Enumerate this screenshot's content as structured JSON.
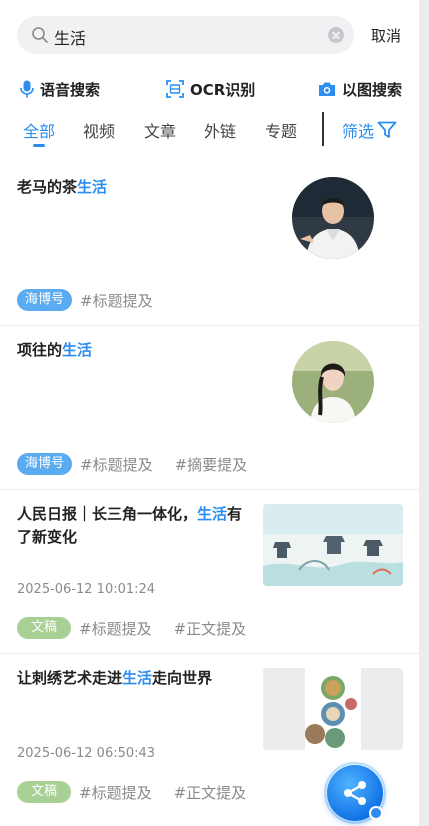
{
  "search": {
    "query": "生活",
    "cancel_label": "取消"
  },
  "tools": [
    {
      "label": "语音搜索",
      "icon": "microphone-icon"
    },
    {
      "label": "OCR识别",
      "icon": "scan-icon"
    },
    {
      "label": "以图搜索",
      "icon": "camera-icon"
    }
  ],
  "tabs": [
    {
      "label": "全部",
      "active": true
    },
    {
      "label": "视频",
      "active": false
    },
    {
      "label": "文章",
      "active": false
    },
    {
      "label": "外链",
      "active": false
    },
    {
      "label": "专题",
      "active": false
    }
  ],
  "filter_label": "筛选",
  "accent_color": "#2b8ef0",
  "results": [
    {
      "title_parts": [
        "老马的茶",
        "生活"
      ],
      "badge": "海博号",
      "tags": [
        "#标题提及"
      ],
      "image": "avatar-man"
    },
    {
      "title_parts": [
        "项往的",
        "生活"
      ],
      "badge": "海博号",
      "tags": [
        "#标题提及",
        "#摘要提及"
      ],
      "image": "avatar-woman"
    },
    {
      "title_parts": [
        "人民日报｜长三角一体化，",
        "生活",
        "有了新变化"
      ],
      "date": "2025-06-12 10:01:24",
      "badge": "文稿",
      "tags": [
        "#标题提及",
        "#正文提及"
      ],
      "image": "ink-painting-thumb"
    },
    {
      "title_parts": [
        "让刺绣艺术走进",
        "生活",
        "走向世界"
      ],
      "date": "2025-06-12 06:50:43",
      "badge": "文稿",
      "tags": [
        "#标题提及",
        "#正文提及"
      ],
      "image": "embroidery-thumb"
    }
  ]
}
